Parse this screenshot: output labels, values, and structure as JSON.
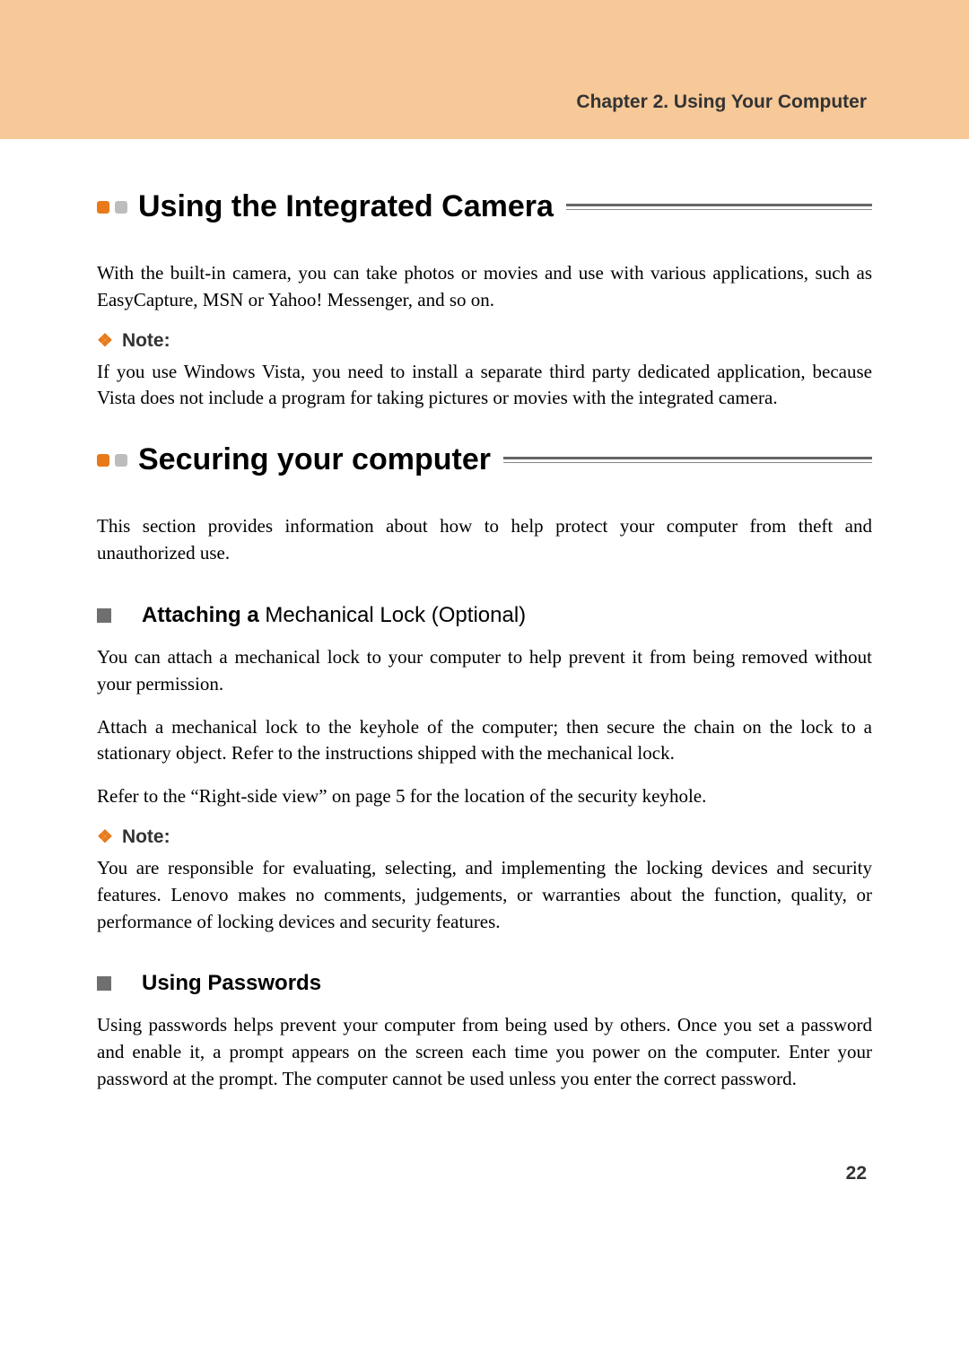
{
  "header": {
    "chapter_label": "Chapter 2. Using Your Computer"
  },
  "section1": {
    "title": "Using the Integrated Camera",
    "para1": "With the built-in camera, you can take photos or movies and use with various applications, such as EasyCapture, MSN or Yahoo! Messenger, and so on.",
    "note_label": "Note:",
    "note_body": "If you use Windows Vista, you need to install a separate third party dedicated application, because Vista does not include a program for taking pictures or movies with the integrated camera."
  },
  "section2": {
    "title": "Securing your computer",
    "intro": "This section provides information about how to help protect your computer from theft and unauthorized use.",
    "sub1": {
      "title_bold": "Attaching a ",
      "title_rest": "Mechanical Lock (Optional)",
      "p1": "You can attach a mechanical lock to your computer to help prevent it from being removed without your permission.",
      "p2": "Attach a mechanical lock to the keyhole of the computer; then secure the chain on the lock to a stationary object. Refer to the instructions shipped with the mechanical lock.",
      "p3": "Refer to the “Right-side view” on page 5 for the location of the security keyhole.",
      "note_label": "Note:",
      "note_body": "You are responsible for evaluating, selecting, and implementing the locking devices and security features. Lenovo makes no comments, judgements, or warranties about the function, quality, or performance of locking devices and security features."
    },
    "sub2": {
      "title_bold": "Using Passwords",
      "p1": "Using passwords helps prevent your computer from being used by others. Once you set a password and enable it, a prompt appears on the screen each time you power on the computer. Enter your password at the prompt. The computer cannot be used unless you enter the correct password."
    }
  },
  "page_number": "22"
}
